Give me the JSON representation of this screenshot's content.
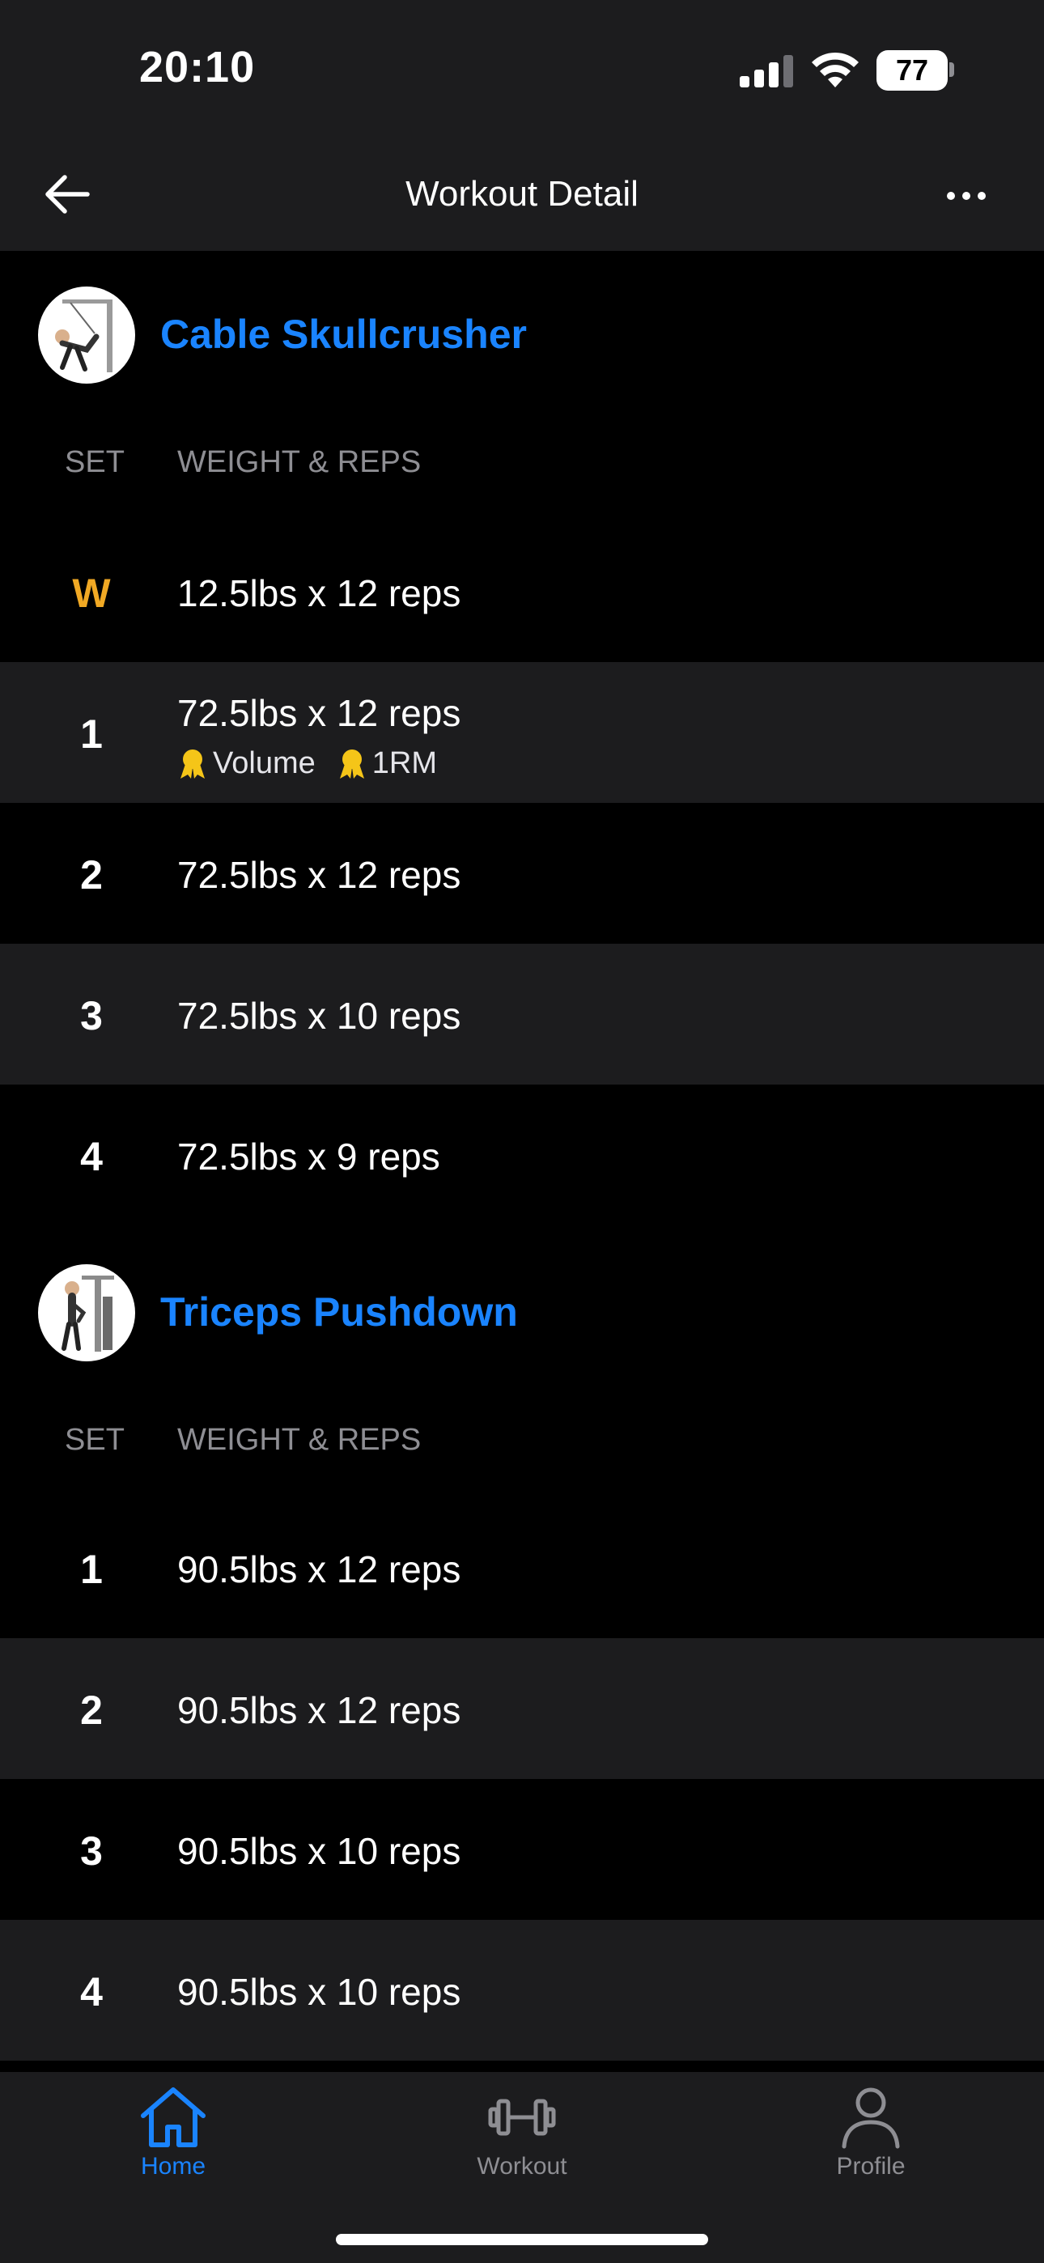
{
  "status_bar": {
    "time": "20:10",
    "battery": "77"
  },
  "nav": {
    "title": "Workout Detail"
  },
  "columns": {
    "set": "SET",
    "weight_reps": "WEIGHT & REPS"
  },
  "exercises": [
    {
      "name": "Cable Skullcrusher",
      "sets": [
        {
          "label": "W",
          "value": "12.5lbs x 12 reps"
        },
        {
          "label": "1",
          "value": "72.5lbs x 12 reps",
          "badges": [
            "Volume",
            "1RM"
          ]
        },
        {
          "label": "2",
          "value": "72.5lbs x 12 reps"
        },
        {
          "label": "3",
          "value": "72.5lbs x 10 reps"
        },
        {
          "label": "4",
          "value": "72.5lbs x 9 reps"
        }
      ]
    },
    {
      "name": "Triceps Pushdown",
      "sets": [
        {
          "label": "1",
          "value": "90.5lbs x 12 reps"
        },
        {
          "label": "2",
          "value": "90.5lbs x 12 reps"
        },
        {
          "label": "3",
          "value": "90.5lbs x 10 reps"
        },
        {
          "label": "4",
          "value": "90.5lbs x 10 reps"
        }
      ]
    }
  ],
  "tabs": [
    {
      "label": "Home",
      "icon": "home-icon",
      "active": true
    },
    {
      "label": "Workout",
      "icon": "dumbbell-icon",
      "active": false
    },
    {
      "label": "Profile",
      "icon": "person-icon",
      "active": false
    }
  ],
  "colors": {
    "accent": "#1a84ff",
    "warmup": "#f1a924",
    "badge": "#f5c518",
    "row_alt": "#1c1c1e"
  }
}
